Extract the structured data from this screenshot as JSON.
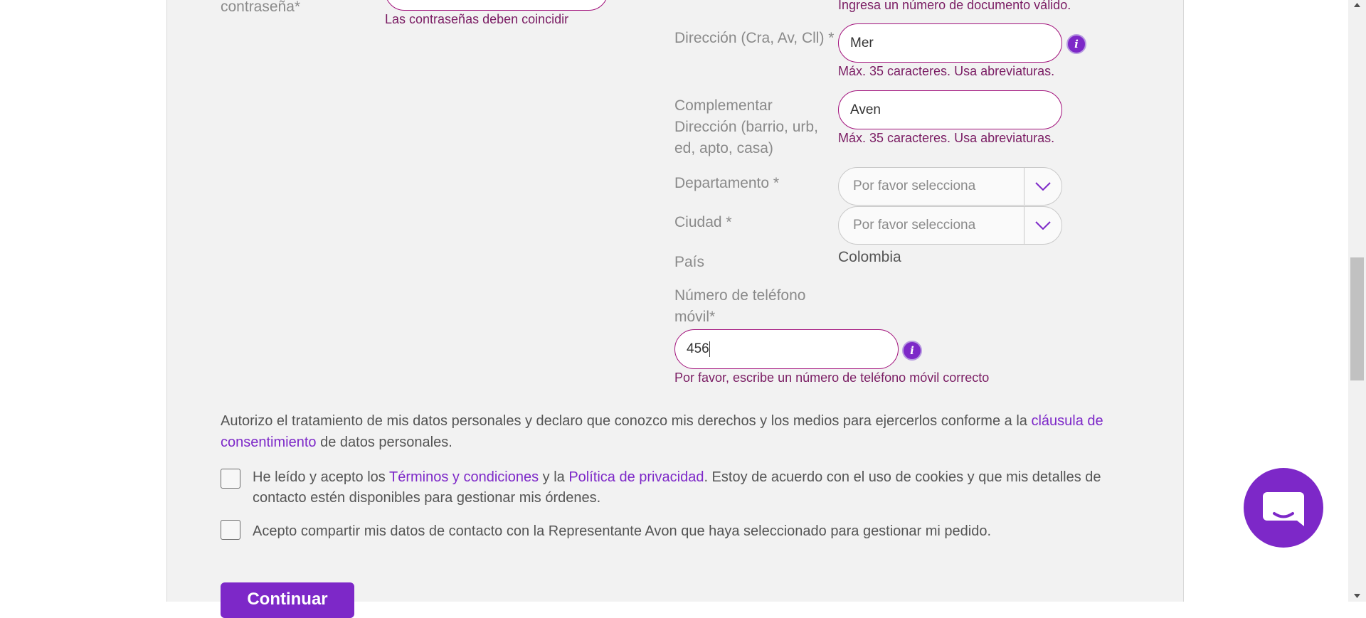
{
  "left": {
    "confirm_password_label": "contraseña*",
    "password_mismatch_error": "Las contraseñas deben coincidir"
  },
  "right": {
    "document_error": "Ingresa un número de documento válido.",
    "address": {
      "label": "Dirección (Cra, Av, Cll) *",
      "value": "Mer",
      "hint": "Máx. 35 caracteres. Usa abreviaturas."
    },
    "address2": {
      "label": "Complementar Dirección (barrio, urb, ed, apto, casa)",
      "value": "Aven",
      "hint": "Máx. 35 caracteres. Usa abreviaturas."
    },
    "department": {
      "label": "Departamento *",
      "placeholder": "Por favor selecciona"
    },
    "city": {
      "label": "Ciudad *",
      "placeholder": "Por favor selecciona"
    },
    "country": {
      "label": "País",
      "value": "Colombia"
    },
    "phone": {
      "label": "Número de teléfono móvil*",
      "value": "456",
      "error": "Por favor, escribe un número de teléfono móvil correcto"
    },
    "info_glyph": "i"
  },
  "consent": {
    "text_before": "Autorizo el tratamiento de mis datos personales y declaro que conozco mis derechos y los medios para ejercerlos conforme a la ",
    "link": "cláusula de consentimiento",
    "text_after": " de datos personales."
  },
  "terms": {
    "t1": "He leído y acepto los ",
    "link1": "Términos y condiciones",
    "t2": " y la ",
    "link2": "Política de privacidad",
    "t3": ". Estoy de acuerdo con el uso de cookies y que mis detalles de contacto estén disponibles para gestionar mis órdenes."
  },
  "share": {
    "text": "Acepto compartir mis datos de contacto con la Representante Avon que haya seleccionado para gestionar mi pedido."
  },
  "continue_label": "Continuar",
  "icons": {
    "info": "info-icon",
    "chevron": "chevron-down-icon",
    "chat": "chat-icon"
  }
}
